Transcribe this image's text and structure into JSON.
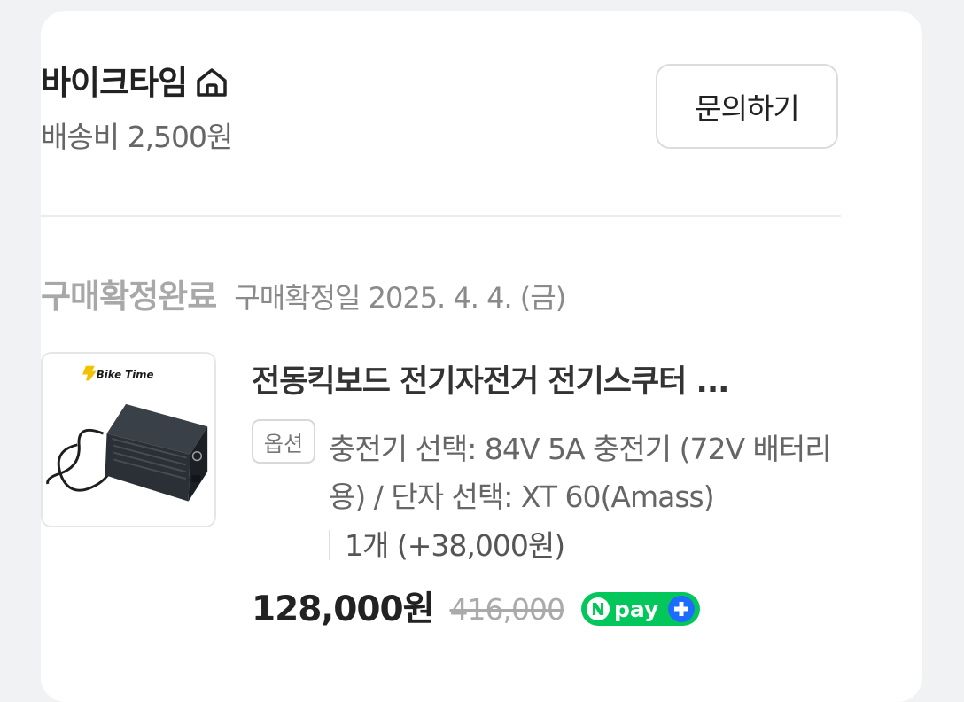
{
  "store": {
    "name": "바이크타임",
    "home_icon": "home-icon",
    "shipping_fee": "배송비 2,500원",
    "inquiry_label": "문의하기"
  },
  "order": {
    "status": "구매확정완료",
    "confirm_date": "구매확정일 2025. 4. 4. (금)"
  },
  "product": {
    "thumbnail_brand": "Bike Time",
    "title": "전동킥보드 전기자전거 전기스쿠터 ...",
    "option_badge": "옵션",
    "option_text": "충전기 선택: 84V 5A 충전기 (72V 배터리용) / 단자 선택: XT 60(Amass)",
    "quantity": "1개 (+38,000원)",
    "price": "128,000원",
    "original_price": "416,000",
    "pay_badge": "npay+",
    "colors": {
      "npay_green": "#03c75a",
      "npay_blue": "#1e6cff"
    }
  }
}
